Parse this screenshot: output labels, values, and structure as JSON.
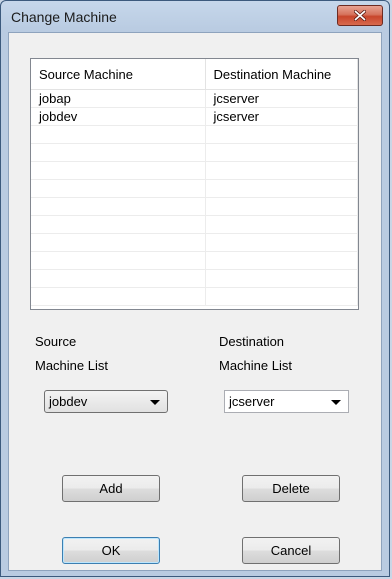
{
  "window": {
    "title": "Change Machine"
  },
  "list": {
    "columns": [
      "Source Machine",
      "Destination Machine"
    ],
    "rows": [
      [
        "jobap",
        "jcserver"
      ],
      [
        "jobdev",
        "jcserver"
      ],
      [
        "",
        ""
      ],
      [
        "",
        ""
      ],
      [
        "",
        ""
      ],
      [
        "",
        ""
      ],
      [
        "",
        ""
      ],
      [
        "",
        ""
      ],
      [
        "",
        ""
      ],
      [
        "",
        ""
      ],
      [
        "",
        ""
      ],
      [
        "",
        ""
      ]
    ]
  },
  "source": {
    "label_line1": "Source",
    "label_line2": "Machine List",
    "selected": "jobdev"
  },
  "destination": {
    "label_line1": "Destination",
    "label_line2": "Machine List",
    "selected": "jcserver"
  },
  "buttons": {
    "add": "Add",
    "delete": "Delete",
    "ok": "OK",
    "cancel": "Cancel"
  },
  "icons": {
    "close": "close-icon",
    "dropdown": "chevron-down-icon"
  }
}
